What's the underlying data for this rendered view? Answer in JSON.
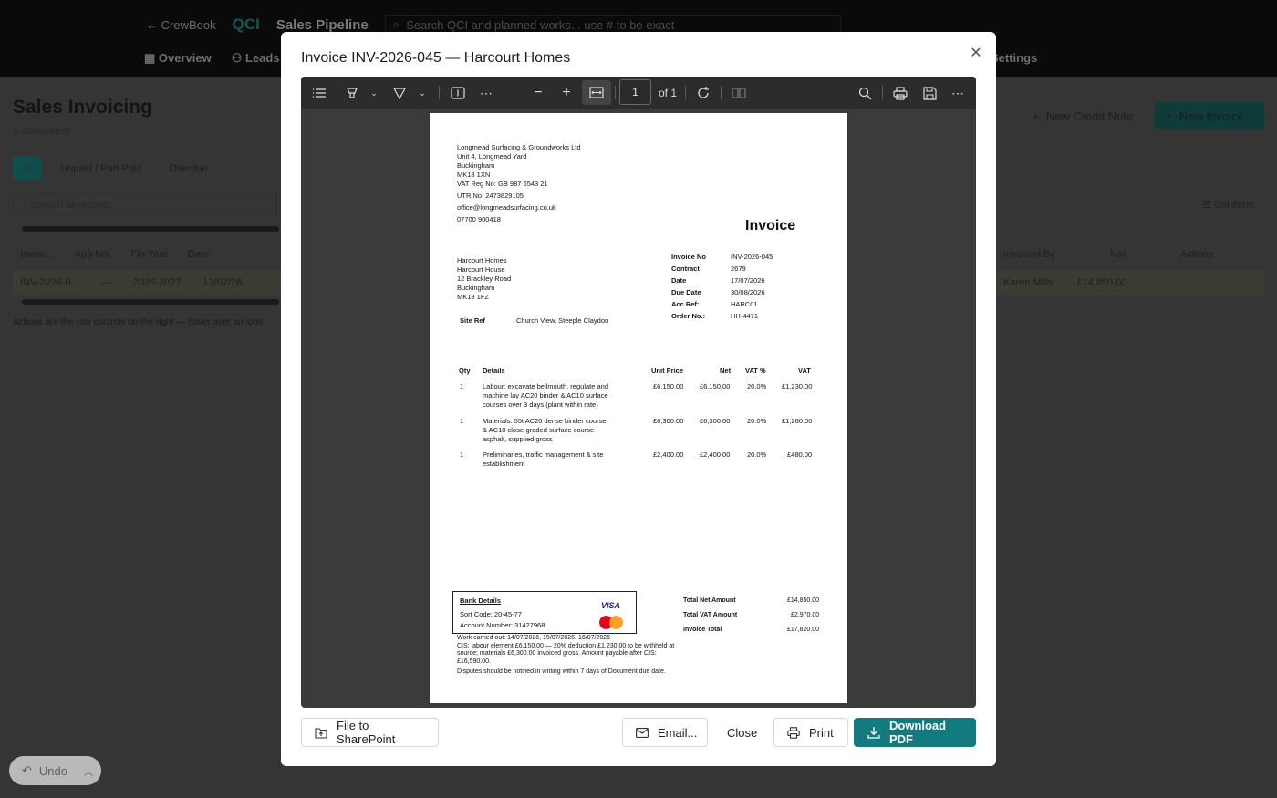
{
  "app": {
    "back_label": "CrewBook",
    "logo": "QCI",
    "section_title": "Sales Pipeline",
    "search_placeholder": "Search QCI and planned works... use # to be exact",
    "nav": [
      "Overview",
      "Leads"
    ],
    "settings_label": "Settings"
  },
  "background_page": {
    "title": "Sales Invoicing",
    "subtitle": "1 document",
    "filters": [
      "All",
      "Unpaid / Part Paid",
      "Overdue"
    ],
    "search_placeholder": "Search all records...",
    "new_credit_note": "New Credit Note",
    "new_invoice": "New Invoice",
    "columns_label": "Columns",
    "left_headers": [
      "Invoic...",
      "App No.",
      "Fin Year",
      "Date"
    ],
    "left_row": [
      "INV-2026-0...",
      "—",
      "2026-2027",
      "17/07/26"
    ],
    "right_headers": [
      "Invoiced By",
      "Net",
      "Actions"
    ],
    "right_row": [
      "Karen Mills",
      "£14,850.00"
    ],
    "note": "Actions are the row controls on the right — hover over an icon"
  },
  "undo_label": "Undo",
  "modal": {
    "title": "Invoice INV-2026-045 — Harcourt Homes",
    "close_icon": "close-icon",
    "viewer": {
      "page_number": "1",
      "page_of": "of 1"
    },
    "invoice": {
      "supplier_lines": [
        "Longmead Surfacing & Groundworks Ltd",
        "Unit 4, Longmead Yard",
        "Buckingham",
        "MK18 1XN",
        "VAT Reg No: GB 987 6543 21"
      ],
      "utr": "UTR No: 2473829105",
      "email": "office@longmeadsurfacing.co.uk",
      "phone": "07700 900418",
      "heading": "Invoice",
      "customer_lines": [
        "Harcourt Homes",
        "Harcourt House",
        "12 Brackley Road",
        "Buckingham",
        "MK18 1FZ"
      ],
      "site_ref_label": "Site Ref",
      "site_ref": "Church View, Steeple Claydon",
      "meta": [
        {
          "label": "Invoice No",
          "value": "INV-2026-045"
        },
        {
          "label": "Contract",
          "value": "2679"
        },
        {
          "label": "Date",
          "value": "17/07/2026"
        },
        {
          "label": "Due Date",
          "value": "30/08/2026"
        },
        {
          "label": "Acc Ref:",
          "value": "HARC01"
        },
        {
          "label": "Order No.:",
          "value": "HH-4471"
        }
      ],
      "table_headers": {
        "qty": "Qty",
        "details": "Details",
        "unit_price": "Unit Price",
        "net": "Net",
        "vat_pct": "VAT %",
        "vat": "VAT"
      },
      "lines": [
        {
          "qty": "1",
          "details": [
            "Labour: excavate bellmouth, regulate and",
            "machine lay AC20 binder & AC10 surface",
            "courses over 3 days (plant within rate)"
          ],
          "unit_price": "£6,150.00",
          "net": "£6,150.00",
          "vat_pct": "20.0%",
          "vat": "£1,230.00"
        },
        {
          "qty": "1",
          "details": [
            "Materials: 55t AC20 dense binder course",
            "& AC10 close-graded surface course",
            "asphalt, supplied gross"
          ],
          "unit_price": "£6,300.00",
          "net": "£6,300.00",
          "vat_pct": "20.0%",
          "vat": "£1,260.00"
        },
        {
          "qty": "1",
          "details": [
            "Preliminaries, traffic management & site",
            "establishment"
          ],
          "unit_price": "£2,400.00",
          "net": "£2,400.00",
          "vat_pct": "20.0%",
          "vat": "£480.00"
        }
      ],
      "bank": {
        "title": "Bank Details",
        "sort_code": "Sort Code: 20-45-77",
        "account": "Account Number: 31427968",
        "visa": "VISA"
      },
      "notes": [
        "Work carried out: 14/07/2026, 15/07/2026, 16/07/2026",
        "CIS: labour element £6,150.00 — 20% deduction £1,230.00 to be withheld at",
        "source; materials £6,300.00 invoiced gross. Amount payable after CIS:",
        "£16,590.00."
      ],
      "disputes": "Disputes should be notified in writing within 7 days of Document due date.",
      "totals": [
        {
          "label": "Total Net Amount",
          "value": "£14,850.00"
        },
        {
          "label": "Total VAT Amount",
          "value": "£2,970.00"
        },
        {
          "label": "Invoice Total",
          "value": "£17,820.00"
        }
      ]
    },
    "buttons": {
      "sharepoint": "File to SharePoint",
      "email": "Email...",
      "close": "Close",
      "print": "Print",
      "download": "Download PDF"
    }
  }
}
